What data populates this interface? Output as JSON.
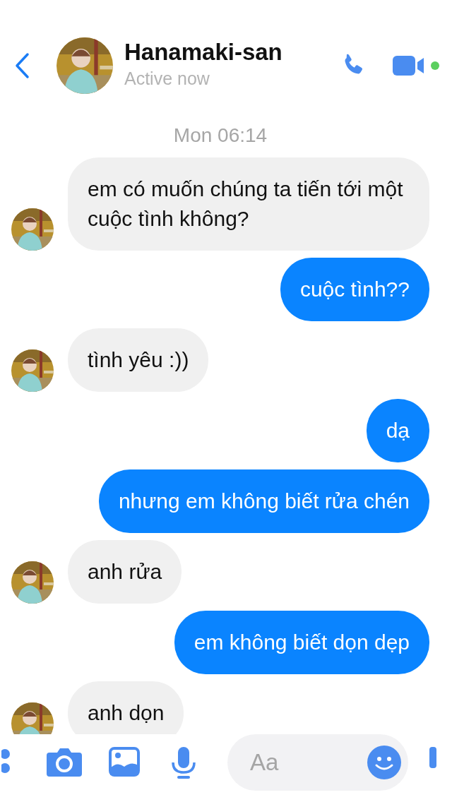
{
  "header": {
    "name": "Hanamaki-san",
    "status": "Active now",
    "online": true
  },
  "timestamp": "Mon 06:14",
  "messages": [
    {
      "kind": "received",
      "text": "em có muốn chúng ta tiến tới một cuộc tình không?"
    },
    {
      "kind": "sent",
      "text": "cuộc tình??"
    },
    {
      "kind": "received",
      "text": "tình yêu :))"
    },
    {
      "kind": "sent",
      "text": "dạ"
    },
    {
      "kind": "sent",
      "text": "nhưng em không biết rửa chén"
    },
    {
      "kind": "received",
      "text": "anh rửa"
    },
    {
      "kind": "sent",
      "text": "em không biết dọn dẹp"
    },
    {
      "kind": "received",
      "text": "anh dọn"
    }
  ],
  "composer": {
    "placeholder": "Aa"
  }
}
